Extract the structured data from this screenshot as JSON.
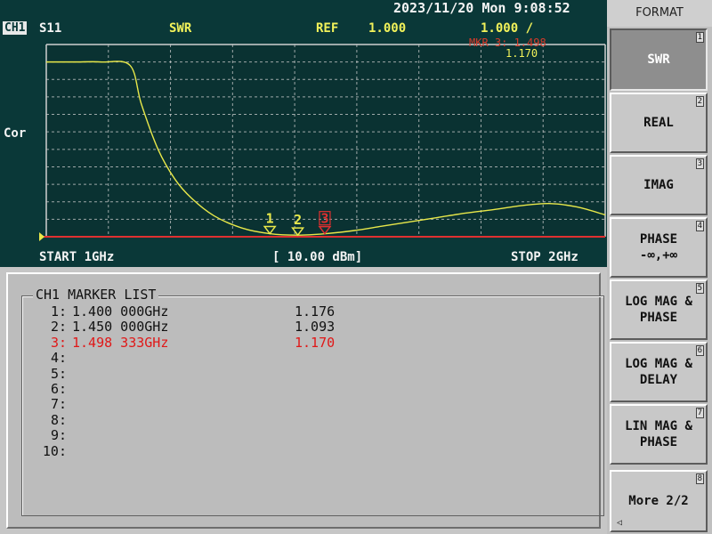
{
  "header": {
    "datetime": "2023/11/20 Mon  9:08:52",
    "channel": "CH1",
    "parameter": "S11",
    "format": "SWR",
    "ref_label": "REF",
    "ref_value": "1.000",
    "scale": "1.000 /",
    "marker_readout": "MKR 3: 1.498",
    "marker_value": "1.170",
    "correction": "Cor"
  },
  "sweep": {
    "start": "START 1GHz",
    "power": "[ 10.00 dBm]",
    "stop": "STOP 2GHz"
  },
  "colors": {
    "trace": "#e8e84a",
    "reference_line": "#e03030",
    "grid": "#d0d0d0",
    "active_marker": "#e03030",
    "plot_bg": "#0a3232"
  },
  "trace": {
    "x_start_ghz": 1.0,
    "x_stop_ghz": 2.0,
    "ref_value": 1.0,
    "scale_per_div": 1.0,
    "points": [
      [
        1.0,
        11.0
      ],
      [
        1.05,
        11.0
      ],
      [
        1.1,
        11.0
      ],
      [
        1.15,
        10.8
      ],
      [
        1.17,
        8.6
      ],
      [
        1.2,
        6.0
      ],
      [
        1.23,
        4.3
      ],
      [
        1.26,
        3.2
      ],
      [
        1.3,
        2.2
      ],
      [
        1.35,
        1.5
      ],
      [
        1.4,
        1.176
      ],
      [
        1.45,
        1.093
      ],
      [
        1.498,
        1.17
      ],
      [
        1.55,
        1.35
      ],
      [
        1.6,
        1.6
      ],
      [
        1.65,
        1.85
      ],
      [
        1.7,
        2.1
      ],
      [
        1.75,
        2.35
      ],
      [
        1.8,
        2.55
      ],
      [
        1.85,
        2.78
      ],
      [
        1.9,
        2.9
      ],
      [
        1.95,
        2.7
      ],
      [
        2.0,
        2.25
      ]
    ]
  },
  "markers": [
    {
      "label": "1",
      "freq_ghz": 1.4,
      "value": 1.176,
      "active": false
    },
    {
      "label": "2",
      "freq_ghz": 1.45,
      "value": 1.093,
      "active": false
    },
    {
      "label": "3",
      "freq_ghz": 1.498333,
      "value": 1.17,
      "active": true
    }
  ],
  "marker_list": {
    "title": "CH1 MARKER LIST",
    "rows": [
      {
        "num": "1:",
        "freq": "1.400 000GHz",
        "value": "1.176",
        "active": false
      },
      {
        "num": "2:",
        "freq": "1.450 000GHz",
        "value": "1.093",
        "active": false
      },
      {
        "num": "3:",
        "freq": "1.498 333GHz",
        "value": "1.170",
        "active": true
      },
      {
        "num": "4:",
        "freq": "",
        "value": "",
        "active": false
      },
      {
        "num": "5:",
        "freq": "",
        "value": "",
        "active": false
      },
      {
        "num": "6:",
        "freq": "",
        "value": "",
        "active": false
      },
      {
        "num": "7:",
        "freq": "",
        "value": "",
        "active": false
      },
      {
        "num": "8:",
        "freq": "",
        "value": "",
        "active": false
      },
      {
        "num": "9:",
        "freq": "",
        "value": "",
        "active": false
      },
      {
        "num": "10:",
        "freq": "",
        "value": "",
        "active": false
      }
    ]
  },
  "softkeys": {
    "title": "FORMAT",
    "items": [
      {
        "label": "SWR",
        "num": "1",
        "selected": true
      },
      {
        "label": "REAL",
        "num": "2",
        "selected": false
      },
      {
        "label": "IMAG",
        "num": "3",
        "selected": false
      },
      {
        "label": "PHASE\n-∞,+∞",
        "num": "4",
        "selected": false
      },
      {
        "label": "LOG MAG &\nPHASE",
        "num": "5",
        "selected": false
      },
      {
        "label": "LOG MAG &\nDELAY",
        "num": "6",
        "selected": false
      },
      {
        "label": "LIN MAG &\nPHASE",
        "num": "7",
        "selected": false
      },
      {
        "label": "More 2/2",
        "num": "8",
        "selected": false
      }
    ],
    "more_arrow_icon": "left-arrow-icon"
  }
}
